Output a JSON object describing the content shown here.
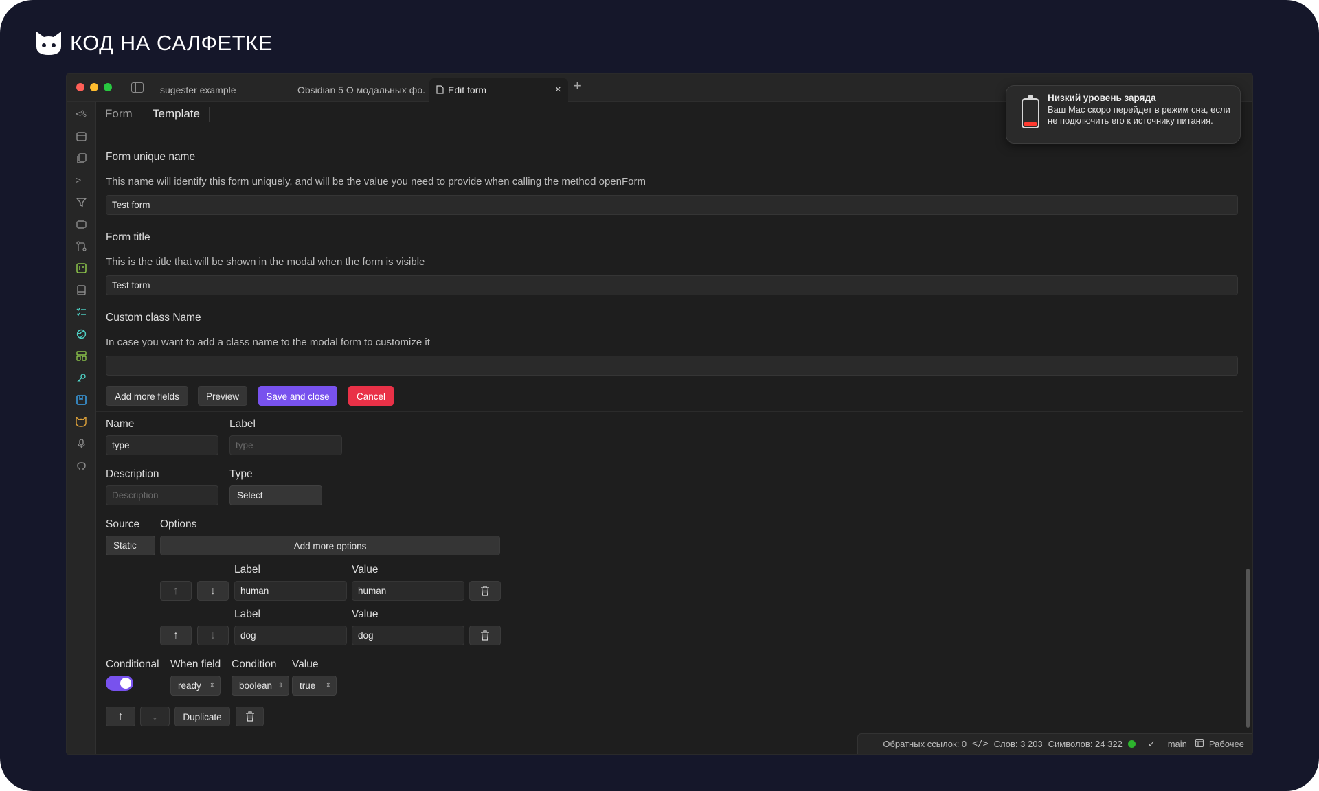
{
  "brand": {
    "title": "КОД НА САЛФЕТКЕ",
    "logo_icon": "cat-face-icon"
  },
  "tabs": [
    {
      "label": "sugester example"
    },
    {
      "label": "Obsidian 5 О модальных фо..."
    },
    {
      "label": "Edit form",
      "close": "×"
    }
  ],
  "tab_add": "+",
  "ribbon_icons": [
    "templater-icon",
    "calendar-icon",
    "copy-icon",
    "terminal-icon",
    "filter-icon",
    "layers-icon",
    "git-branch-icon",
    "kanban-icon",
    "book-icon",
    "checklist-icon",
    "globe-icon",
    "dashboard-icon",
    "key-icon",
    "bookmark-icon",
    "cat-icon",
    "microphone-icon",
    "github-icon"
  ],
  "view_tabs": {
    "form": "Form",
    "template": "Template"
  },
  "form": {
    "unique_name_label": "Form unique name",
    "unique_name_desc": "This name will identify this form uniquely, and will be the value you need to provide when calling the method openForm",
    "unique_name_value": "Test form",
    "title_label": "Form title",
    "title_desc": "This is the title that will be shown in the modal when the form is visible",
    "title_value": "Test form",
    "class_label": "Custom class Name",
    "class_desc": "In case you want to add a class name to the modal form to customize it",
    "class_value": ""
  },
  "actions": {
    "add_fields": "Add more fields",
    "preview": "Preview",
    "save_close": "Save and close",
    "cancel": "Cancel"
  },
  "field": {
    "name_label": "Name",
    "name_value": "type",
    "label_label": "Label",
    "label_placeholder": "type",
    "description_label": "Description",
    "description_placeholder": "Description",
    "type_label": "Type",
    "type_value": "Select",
    "source_label": "Source",
    "source_value": "Static",
    "options_label": "Options",
    "add_options": "Add more options",
    "options": [
      {
        "label_header": "Label",
        "value_header": "Value",
        "label": "human",
        "value": "human"
      },
      {
        "label_header": "Label",
        "value_header": "Value",
        "label": "dog",
        "value": "dog"
      }
    ],
    "conditional_label": "Conditional",
    "conditional_on": true,
    "when_field_label": "When field",
    "when_field_value": "ready",
    "condition_label": "Condition",
    "condition_value": "boolean",
    "value_label": "Value",
    "value_value": "true",
    "duplicate": "Duplicate",
    "arrow_up": "↑",
    "arrow_down": "↓",
    "trash_icon": "trash-icon"
  },
  "status": {
    "backlinks": "Обратных ссылок: 0",
    "words": "Слов: 3 203",
    "chars": "Символов: 24 322",
    "branch": "main",
    "workspace": "Рабочее",
    "sync_color": "#2db42d"
  },
  "notification": {
    "title": "Низкий уровень заряда",
    "body": "Ваш Mac скоро перейдет в режим сна, если не подключить его к источнику питания."
  },
  "colors": {
    "accent": "#7852ee",
    "danger": "#e93147",
    "traffic_red": "#ff5f57",
    "traffic_yellow": "#febc2e",
    "traffic_green": "#28c840"
  }
}
